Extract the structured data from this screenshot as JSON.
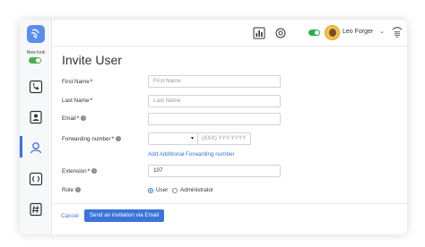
{
  "rail": {
    "new_look_label": "New look",
    "items": [
      {
        "icon": "phone-icon"
      },
      {
        "icon": "contacts-icon"
      },
      {
        "icon": "user-admin-icon"
      },
      {
        "icon": "voicemail-icon"
      },
      {
        "icon": "fax-icon"
      }
    ]
  },
  "topbar": {
    "user_name": "Leo Forger",
    "chevron": "⌄"
  },
  "page": {
    "title": "Invite User"
  },
  "form": {
    "first_name_label": "First Name",
    "first_name_placeholder": "First Name",
    "last_name_label": "Last Name",
    "last_name_placeholder": "Last Name",
    "email_label": "Email",
    "forwarding_label": "Forwarding number",
    "forwarding_placeholder": "(XXX) YYY-YYYY",
    "add_forwarding_link": "Add Additional Forwarding number",
    "extension_label": "Extension",
    "extension_value": "107",
    "role_label": "Role",
    "role_options": [
      "User",
      "Administrator"
    ],
    "role_selected": "User",
    "required_mark": "*",
    "info_mark": "i"
  },
  "footer": {
    "cancel_label": "Cancel",
    "submit_label": "Send an invitation via Email"
  },
  "colors": {
    "accent": "#3b73d9",
    "required": "#d32f2f",
    "toggle_on": "#2eae4f"
  }
}
